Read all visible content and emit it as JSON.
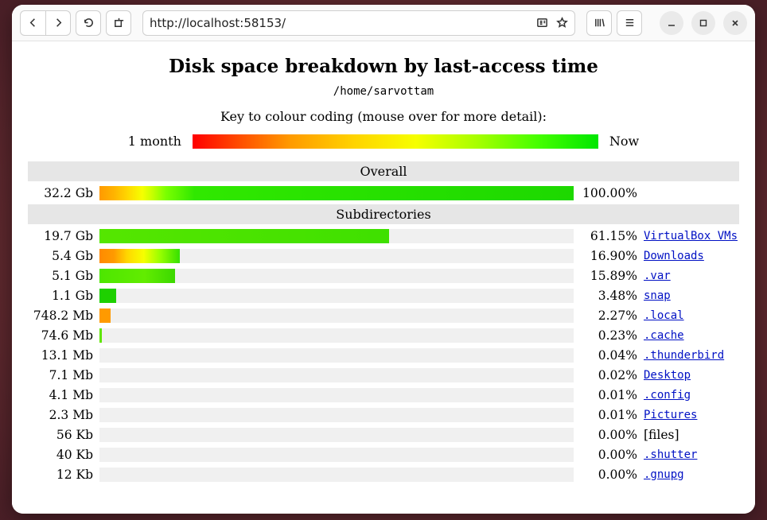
{
  "browser": {
    "url": "http://localhost:58153/"
  },
  "page": {
    "title": "Disk space breakdown by last-access time",
    "path": "/home/sarvottam",
    "key_text": "Key to colour coding (mouse over for more detail):",
    "legend_left": "1 month",
    "legend_right": "Now",
    "section_overall": "Overall",
    "section_subdirs": "Subdirectories"
  },
  "overall": {
    "size": "32.2 Gb",
    "percent": "100.00%",
    "fill_pct": 100,
    "gradient": "linear-gradient(to right, #ff9a00 0%, #ffb300 3%, #ffd800 6%, #f6ff00 9%, #caff00 11%, #7bff00 14%, #30e800 20%, #1dd800 100%)"
  },
  "rows": [
    {
      "size": "19.7 Gb",
      "percent": "61.15%",
      "name": "VirtualBox VMs",
      "link": true,
      "fill_pct": 61.15,
      "gradient": "linear-gradient(to right, #55e600 0%, #3fe000 100%)"
    },
    {
      "size": "5.4 Gb",
      "percent": "16.90%",
      "name": "Downloads",
      "link": true,
      "fill_pct": 16.9,
      "gradient": "linear-gradient(to right, #ff8a00 0%, #ff9a00 18%, #ffd800 35%, #f6ff00 55%, #9aff00 75%, #35e000 100%)"
    },
    {
      "size": "5.1 Gb",
      "percent": "15.89%",
      "name": ".var",
      "link": true,
      "fill_pct": 15.89,
      "gradient": "linear-gradient(to right, #4de600 0%, #62ec00 60%, #3bd800 100%)"
    },
    {
      "size": "1.1 Gb",
      "percent": "3.48%",
      "name": "snap",
      "link": true,
      "fill_pct": 3.48,
      "gradient": "linear-gradient(to right, #1ed000 0%, #1ed000 100%)"
    },
    {
      "size": "748.2 Mb",
      "percent": "2.27%",
      "name": ".local",
      "link": true,
      "fill_pct": 2.27,
      "gradient": "linear-gradient(to right, #ff9a00 0%, #ff9a00 100%)"
    },
    {
      "size": "74.6 Mb",
      "percent": "0.23%",
      "name": ".cache",
      "link": true,
      "fill_pct": 0.45,
      "gradient": "linear-gradient(to right, #5fe600 0%, #5fe600 100%)"
    },
    {
      "size": "13.1 Mb",
      "percent": "0.04%",
      "name": ".thunderbird",
      "link": true,
      "fill_pct": 0,
      "gradient": "none"
    },
    {
      "size": "7.1 Mb",
      "percent": "0.02%",
      "name": "Desktop",
      "link": true,
      "fill_pct": 0,
      "gradient": "none"
    },
    {
      "size": "4.1 Mb",
      "percent": "0.01%",
      "name": ".config",
      "link": true,
      "fill_pct": 0,
      "gradient": "none"
    },
    {
      "size": "2.3 Mb",
      "percent": "0.01%",
      "name": "Pictures",
      "link": true,
      "fill_pct": 0,
      "gradient": "none"
    },
    {
      "size": "56 Kb",
      "percent": "0.00%",
      "name": "[files]",
      "link": false,
      "fill_pct": 0,
      "gradient": "none"
    },
    {
      "size": "40 Kb",
      "percent": "0.00%",
      "name": ".shutter",
      "link": true,
      "fill_pct": 0,
      "gradient": "none"
    },
    {
      "size": "12 Kb",
      "percent": "0.00%",
      "name": ".gnupg",
      "link": true,
      "fill_pct": 0,
      "gradient": "none"
    }
  ],
  "chart_data": {
    "type": "bar",
    "title": "Disk space breakdown by last-access time",
    "path": "/home/sarvottam",
    "color_scale": {
      "left_label": "1 month",
      "right_label": "Now",
      "colors": [
        "#ff0000",
        "#ff9a00",
        "#ffd800",
        "#f6ff00",
        "#7bff00",
        "#1ed000"
      ]
    },
    "overall": {
      "size_label": "32.2 Gb",
      "percent": 100.0
    },
    "categories": [
      "VirtualBox VMs",
      "Downloads",
      ".var",
      "snap",
      ".local",
      ".cache",
      ".thunderbird",
      "Desktop",
      ".config",
      "Pictures",
      "[files]",
      ".shutter",
      ".gnupg"
    ],
    "series": [
      {
        "name": "percent_of_total",
        "values": [
          61.15,
          16.9,
          15.89,
          3.48,
          2.27,
          0.23,
          0.04,
          0.02,
          0.01,
          0.01,
          0.0,
          0.0,
          0.0
        ]
      }
    ],
    "size_labels": [
      "19.7 Gb",
      "5.4 Gb",
      "5.1 Gb",
      "1.1 Gb",
      "748.2 Mb",
      "74.6 Mb",
      "13.1 Mb",
      "7.1 Mb",
      "4.1 Mb",
      "2.3 Mb",
      "56 Kb",
      "40 Kb",
      "12 Kb"
    ],
    "xlabel": "",
    "ylabel": "",
    "ylim": [
      0,
      100
    ]
  }
}
